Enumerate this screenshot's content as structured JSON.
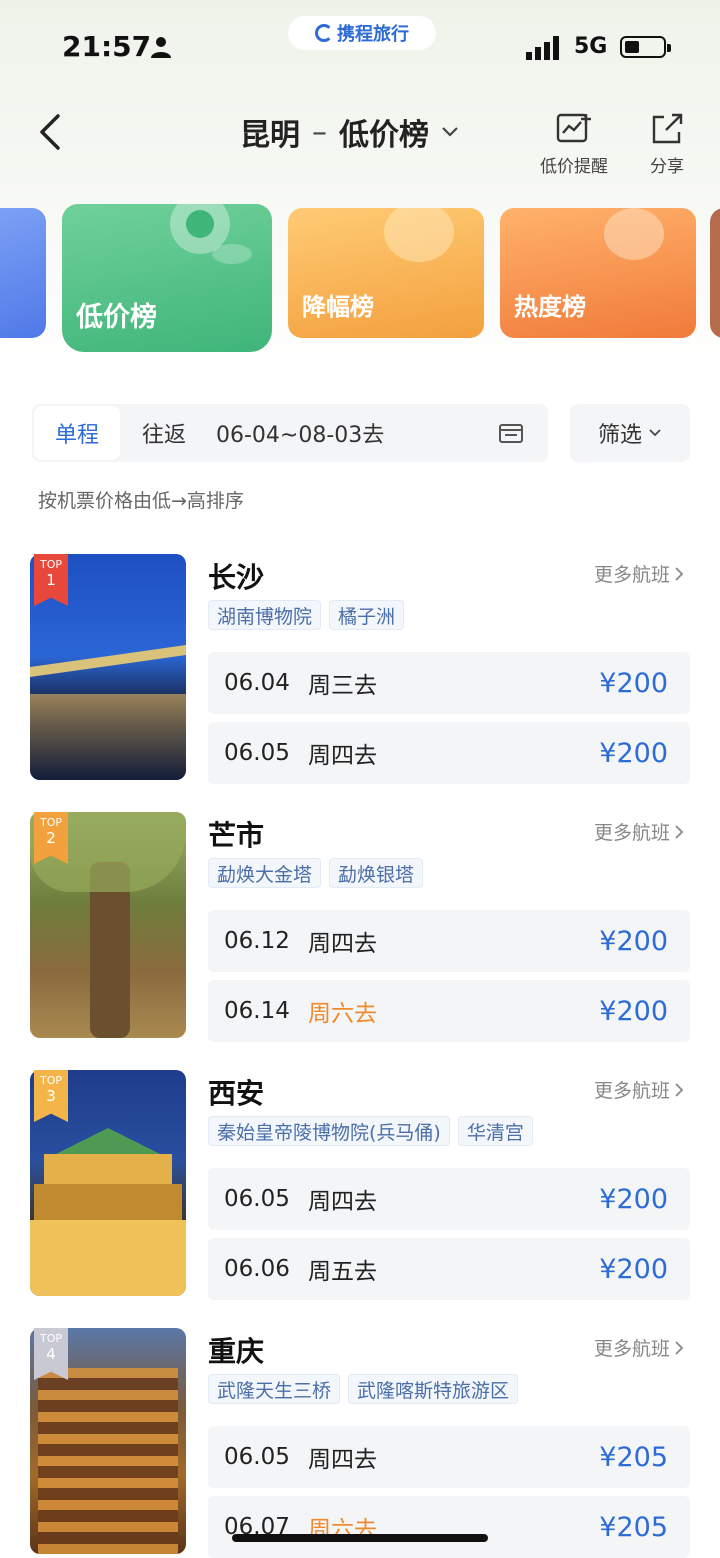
{
  "status_bar": {
    "time": "21:57",
    "network": "5G"
  },
  "app_banner": {
    "name": "携程旅行"
  },
  "nav": {
    "origin": "昆明",
    "separator": "–",
    "board": "低价榜",
    "alert_label": "低价提醒",
    "share_label": "分享"
  },
  "tiles": [
    {
      "label": "低价榜",
      "active": true
    },
    {
      "label": "降幅榜",
      "active": false
    },
    {
      "label": "热度榜",
      "active": false
    }
  ],
  "filter": {
    "oneway": "单程",
    "roundtrip": "往返",
    "date_range": "06-04~08-03去",
    "filter_label": "筛选"
  },
  "sort_note": "按机票价格由低→高排序",
  "more_label": "更多航班",
  "top_label": "TOP",
  "destinations": [
    {
      "rank": "1",
      "city": "长沙",
      "tags": [
        "湖南博物院",
        "橘子洲"
      ],
      "fares": [
        {
          "date": "06.04",
          "day": "周三去",
          "price": "¥200"
        },
        {
          "date": "06.05",
          "day": "周四去",
          "price": "¥200"
        }
      ]
    },
    {
      "rank": "2",
      "city": "芒市",
      "tags": [
        "勐焕大金塔",
        "勐焕银塔"
      ],
      "fares": [
        {
          "date": "06.12",
          "day": "周四去",
          "price": "¥200"
        },
        {
          "date": "06.14",
          "day": "周六去",
          "price": "¥200"
        }
      ]
    },
    {
      "rank": "3",
      "city": "西安",
      "tags": [
        "秦始皇帝陵博物院(兵马俑)",
        "华清宫"
      ],
      "fares": [
        {
          "date": "06.05",
          "day": "周四去",
          "price": "¥200"
        },
        {
          "date": "06.06",
          "day": "周五去",
          "price": "¥200"
        }
      ]
    },
    {
      "rank": "4",
      "city": "重庆",
      "tags": [
        "武隆天生三桥",
        "武隆喀斯特旅游区"
      ],
      "fares": [
        {
          "date": "06.05",
          "day": "周四去",
          "price": "¥205"
        },
        {
          "date": "06.07",
          "day": "周六去",
          "price": "¥205"
        }
      ]
    }
  ],
  "colors": {
    "accent": "#2d6bd6",
    "weekend": "#f08a2c",
    "low_tile": "#3fb57a",
    "drop_tile": "#f3a03e",
    "hot_tile": "#f17a3a"
  }
}
